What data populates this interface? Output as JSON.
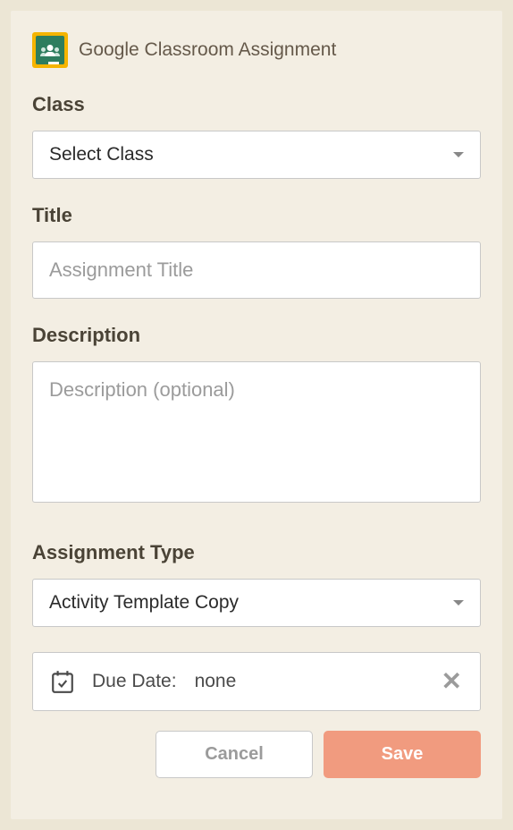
{
  "header": {
    "title": "Google Classroom Assignment"
  },
  "classField": {
    "label": "Class",
    "selected": "Select Class"
  },
  "titleField": {
    "label": "Title",
    "placeholder": "Assignment Title",
    "value": ""
  },
  "descriptionField": {
    "label": "Description",
    "placeholder": "Description (optional)",
    "value": ""
  },
  "assignmentType": {
    "label": "Assignment Type",
    "selected": "Activity Template Copy"
  },
  "dueDate": {
    "label": "Due Date:",
    "value": "none"
  },
  "buttons": {
    "cancel": "Cancel",
    "save": "Save"
  }
}
